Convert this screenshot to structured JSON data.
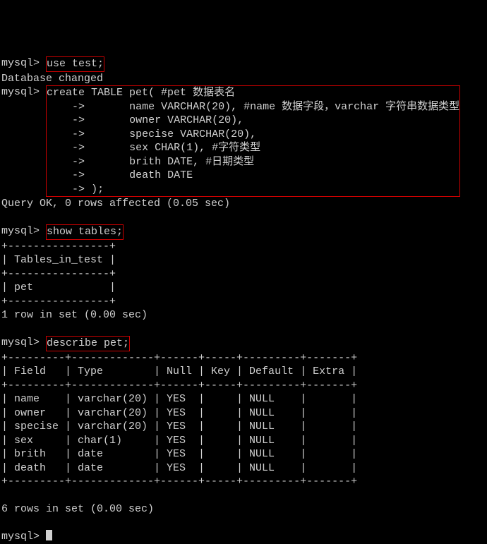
{
  "prompt": "mysql>",
  "cont": "    ->",
  "cmd1": "use test;",
  "resp1": "Database changed",
  "create": {
    "l1": "create TABLE pet( #pet 数据表名",
    "l2": "      name VARCHAR(20), #name 数据字段，varchar 字符串数据类型",
    "l3": "      owner VARCHAR(20),",
    "l4": "      specise VARCHAR(20),",
    "l5": "      sex CHAR(1), #字符类型",
    "l6": "      brith DATE, #日期类型",
    "l7": "      death DATE",
    "l8": ");"
  },
  "resp2": "Query OK, 0 rows affected (0.05 sec)",
  "cmd3": "show tables;",
  "tables": {
    "border": "+----------------+",
    "header": "| Tables_in_test |",
    "row": "| pet            |"
  },
  "resp3": "1 row in set (0.00 sec)",
  "cmd4": "describe pet;",
  "desc": {
    "border": "+---------+-------------+------+-----+---------+-------+",
    "header": "| Field   | Type        | Null | Key | Default | Extra |",
    "r1": "| name    | varchar(20) | YES  |     | NULL    |       |",
    "r2": "| owner   | varchar(20) | YES  |     | NULL    |       |",
    "r3": "| specise | varchar(20) | YES  |     | NULL    |       |",
    "r4": "| sex     | char(1)     | YES  |     | NULL    |       |",
    "r5": "| brith   | date        | YES  |     | NULL    |       |",
    "r6": "| death   | date        | YES  |     | NULL    |       |"
  },
  "resp4": "6 rows in set (0.00 sec)",
  "chart_data": {
    "type": "table",
    "title": "describe pet",
    "columns": [
      "Field",
      "Type",
      "Null",
      "Key",
      "Default",
      "Extra"
    ],
    "rows": [
      [
        "name",
        "varchar(20)",
        "YES",
        "",
        "NULL",
        ""
      ],
      [
        "owner",
        "varchar(20)",
        "YES",
        "",
        "NULL",
        ""
      ],
      [
        "specise",
        "varchar(20)",
        "YES",
        "",
        "NULL",
        ""
      ],
      [
        "sex",
        "char(1)",
        "YES",
        "",
        "NULL",
        ""
      ],
      [
        "brith",
        "date",
        "YES",
        "",
        "NULL",
        ""
      ],
      [
        "death",
        "date",
        "YES",
        "",
        "NULL",
        ""
      ]
    ]
  }
}
